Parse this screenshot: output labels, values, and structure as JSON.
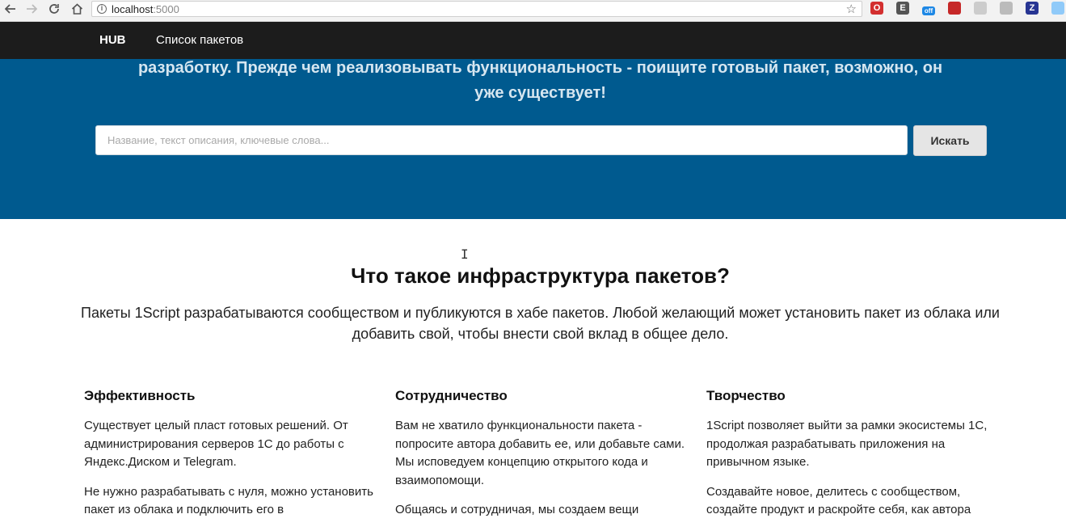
{
  "browser": {
    "back_icon": "arrow-left-icon",
    "forward_icon": "arrow-right-icon",
    "reload_icon": "reload-icon",
    "home_icon": "home-icon",
    "url_host": "localhost",
    "url_port": ":5000",
    "extensions": [
      {
        "name": "opera-ext-icon",
        "label": "O",
        "color": "#d32f2f"
      },
      {
        "name": "evernote-ext-icon",
        "label": "E",
        "color": "#555555"
      },
      {
        "name": "off-ext-icon",
        "label": "off",
        "color": "#1e88e5"
      },
      {
        "name": "bookmark-ext-icon",
        "label": "",
        "color": "#c62828"
      },
      {
        "name": "camera-ext-icon",
        "label": "",
        "color": "#cccccc"
      },
      {
        "name": "figure-ext-icon",
        "label": "",
        "color": "#bbbbbb"
      },
      {
        "name": "z-ext-icon",
        "label": "Z",
        "color": "#283593"
      },
      {
        "name": "windows-ext-icon",
        "label": "",
        "color": "#90caf9"
      }
    ]
  },
  "navbar": {
    "brand": "HUB",
    "link_packages": "Список пакетов"
  },
  "hero": {
    "text": "разработку. Прежде чем реализовывать функциональность - поищите готовый пакет, возможно, он уже существует!",
    "search_placeholder": "Название, текст описания, ключевые слова...",
    "search_button": "Искать"
  },
  "main": {
    "title": "Что такое инфраструктура пакетов?",
    "subtitle": "Пакеты 1Script разрабатываются сообществом и публикуются в хабе пакетов. Любой желающий может установить пакет из облака или добавить свой, чтобы внести свой вклад в общее дело.",
    "features": [
      {
        "title": "Эффективность",
        "paragraphs": [
          "Существует целый пласт готовых решений. От администрирования серверов 1С до работы с Яндекс.Диском и Telegram.",
          "Не нужно разрабатывать с нуля, можно установить пакет из облака и подключить его в"
        ]
      },
      {
        "title": "Сотрудничество",
        "paragraphs": [
          "Вам не хватило функциональности пакета - попросите автора добавить ее, или добавьте сами. Мы исповедуем концепцию открытого кода и взаимопомощи.",
          "Общаясь и сотрудничая, мы создаем вещи"
        ]
      },
      {
        "title": "Творчество",
        "paragraphs": [
          "1Script позволяет выйти за рамки экосистемы 1С, продолжая разрабатывать приложения на привычном языке.",
          "Создавайте новое, делитесь с сообществом, создайте продукт и раскройте себя, как автора"
        ]
      }
    ]
  }
}
